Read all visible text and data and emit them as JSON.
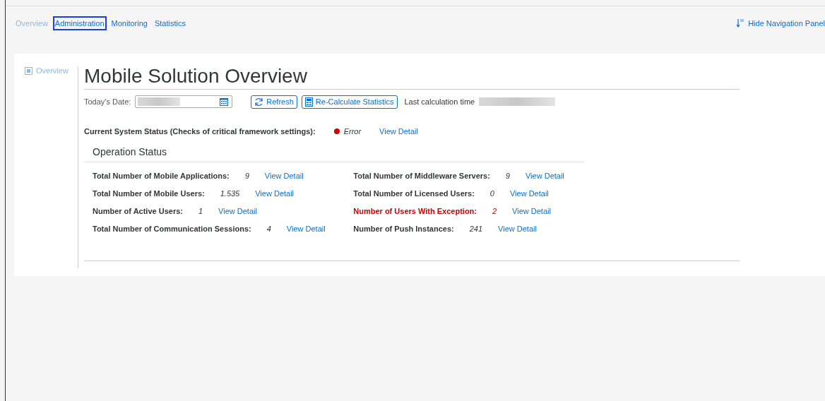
{
  "nav_tabs": [
    {
      "label": "Overview",
      "selected": true,
      "focused": false
    },
    {
      "label": "Administration",
      "selected": false,
      "focused": true
    },
    {
      "label": "Monitoring",
      "selected": false,
      "focused": false
    },
    {
      "label": "Statistics",
      "selected": false,
      "focused": false
    }
  ],
  "hide_panel": {
    "label": "Hide Navigation Panel"
  },
  "sidebar": {
    "items": [
      {
        "label": "Overview"
      }
    ]
  },
  "title": "Mobile Solution Overview",
  "toolbar": {
    "date_label": "Today's Date:",
    "refresh": "Refresh",
    "recalculate": "Re-Calculate Statistics",
    "last_calc_label": "Last calculation time"
  },
  "system_status": {
    "label": "Current System Status (Checks of critical framework settings):",
    "status": "Error",
    "color": "#cc0000",
    "link": "View Detail"
  },
  "operation_status": {
    "title": "Operation Status",
    "left": [
      {
        "label": "Total Number of Mobile Applications:",
        "value": "9",
        "link": "View Detail",
        "alert": false
      },
      {
        "label": "Total Number of Mobile Users:",
        "value": "1.535",
        "link": "View Detail",
        "alert": false
      },
      {
        "label": "Number of Active Users:",
        "value": "1",
        "link": "View Detail",
        "alert": false
      },
      {
        "label": "Total Number of Communication Sessions:",
        "value": "4",
        "link": "View Detail",
        "alert": false
      }
    ],
    "right": [
      {
        "label": "Total Number of Middleware Servers:",
        "value": "9",
        "link": "View Detail",
        "alert": false
      },
      {
        "label": "Total Number of Licensed Users:",
        "value": "0",
        "link": "View Detail",
        "alert": false
      },
      {
        "label": "Number of Users With Exception:",
        "value": "2",
        "link": "View Detail",
        "alert": true
      },
      {
        "label": "Number of Push Instances:",
        "value": "241",
        "link": "View Detail",
        "alert": false
      }
    ]
  }
}
